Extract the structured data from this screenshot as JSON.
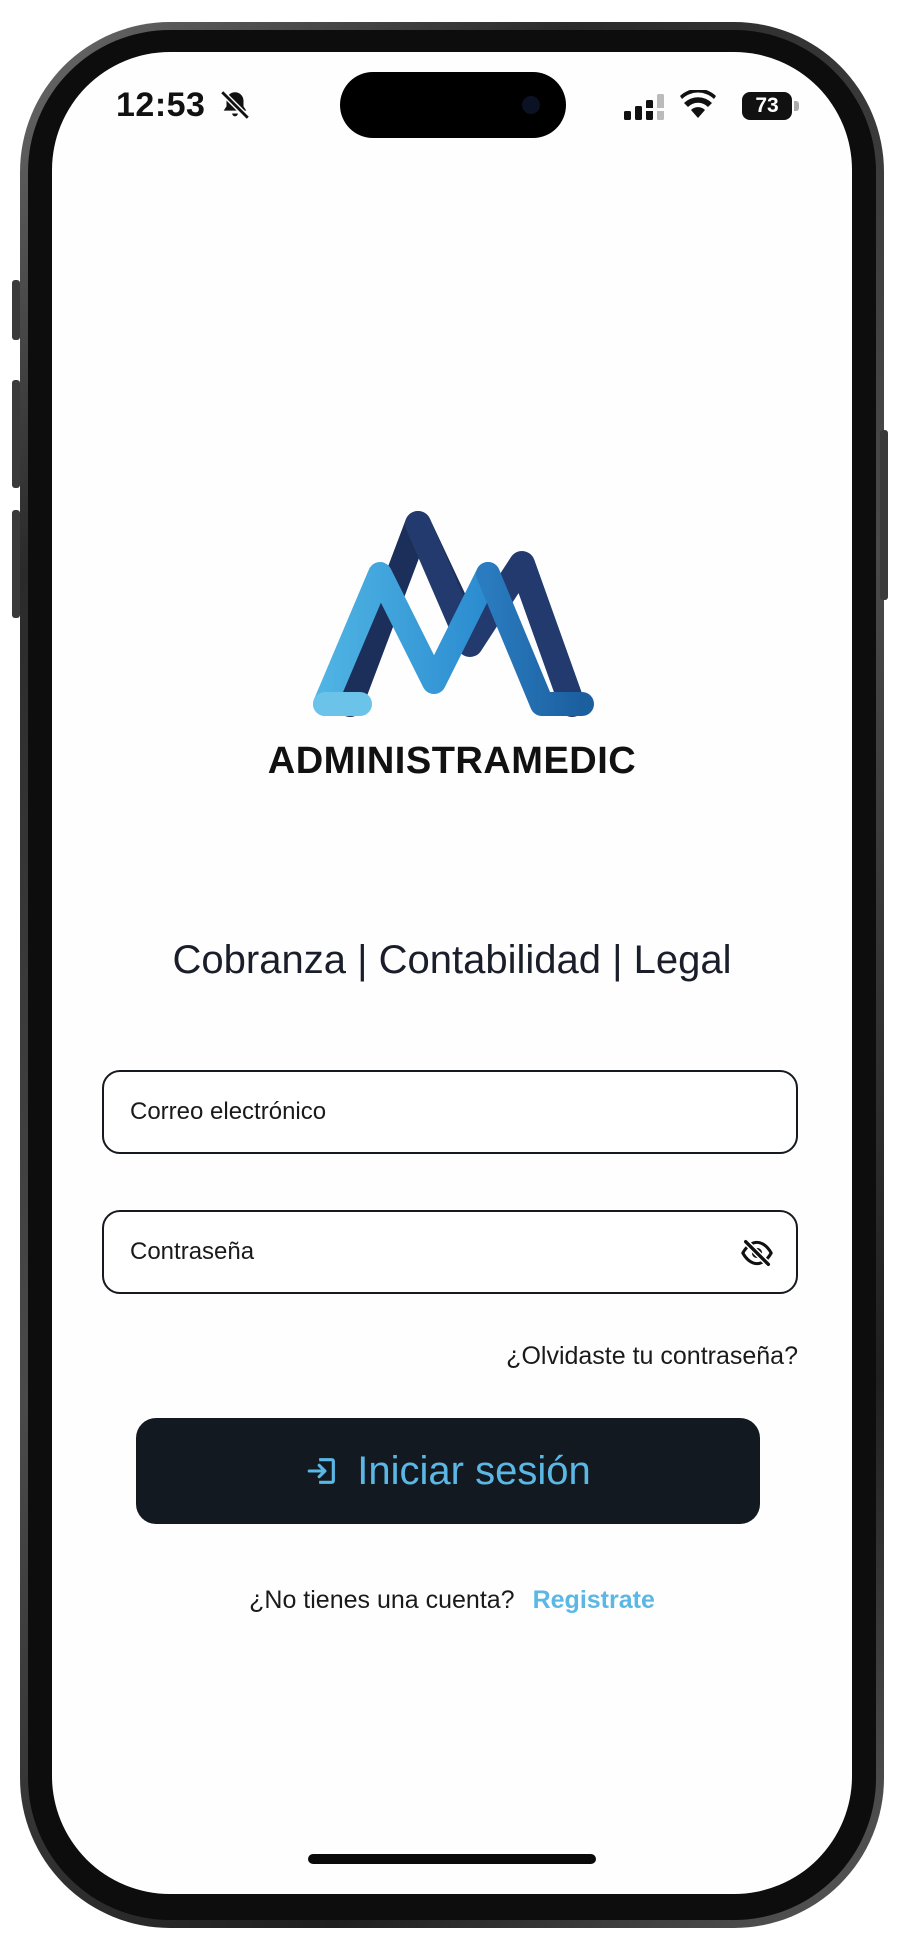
{
  "status_bar": {
    "time": "12:53",
    "battery": "73",
    "icons": [
      "bell-slash-icon",
      "signal-icon",
      "wifi-icon",
      "battery-icon"
    ]
  },
  "brand": {
    "name": "ADMINISTRAMEDIC",
    "tagline": "Cobranza | Contabilidad | Legal",
    "colors": {
      "light_blue": "#4fb3e3",
      "mid_blue": "#2a7bbf",
      "navy": "#1c2f5a"
    }
  },
  "form": {
    "email_placeholder": "Correo electrónico",
    "email_value": "",
    "password_placeholder": "Contraseña",
    "password_value": "",
    "forgot_label": "¿Olvidaste tu contraseña?",
    "login_label": "Iniciar sesión",
    "no_account_label": "¿No tienes una cuenta?",
    "register_label": "Registrate"
  },
  "theme": {
    "button_bg": "#131921",
    "accent": "#5bb8e4"
  }
}
